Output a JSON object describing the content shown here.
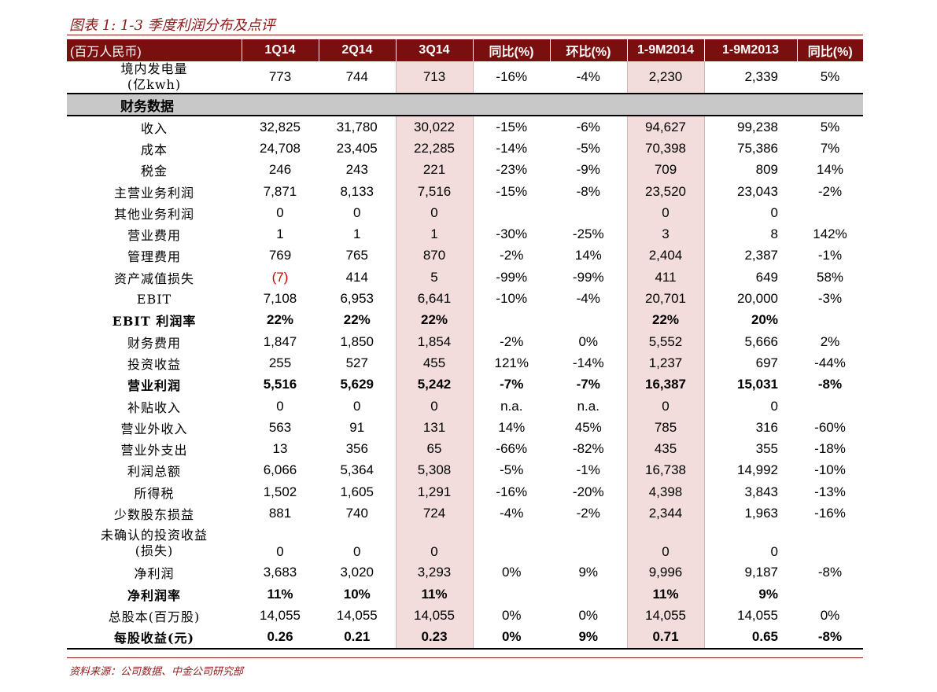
{
  "title": "图表 1: 1-3 季度利润分布及点评",
  "source": "资料来源：公司数据、中金公司研究部",
  "accent_color": "#7a0f0f",
  "highlight_color": "#f2dcdc",
  "headers": [
    "(百万人民币)",
    "1Q14",
    "2Q14",
    "3Q14",
    "同比(%)",
    "环比(%)",
    "1-9M2014",
    "1-9M2013",
    "同比(%)"
  ],
  "electricity": {
    "label_l1": "境内发电量",
    "label_l2": "(亿kwh)",
    "values": [
      "773",
      "744",
      "713",
      "-16%",
      "-4%",
      "2,230",
      "2,339",
      "5%"
    ]
  },
  "section_label": "财务数据",
  "rows": [
    {
      "label": "收入",
      "values": [
        "32,825",
        "31,780",
        "30,022",
        "-15%",
        "-6%",
        "94,627",
        "99,238",
        "5%"
      ]
    },
    {
      "label": "成本",
      "values": [
        "24,708",
        "23,405",
        "22,285",
        "-14%",
        "-5%",
        "70,398",
        "75,386",
        "7%"
      ]
    },
    {
      "label": "税金",
      "values": [
        "246",
        "243",
        "221",
        "-23%",
        "-9%",
        "709",
        "809",
        "14%"
      ]
    },
    {
      "label": "主营业务利润",
      "values": [
        "7,871",
        "8,133",
        "7,516",
        "-15%",
        "-8%",
        "23,520",
        "23,043",
        "-2%"
      ]
    },
    {
      "label": "其他业务利润",
      "values": [
        "0",
        "0",
        "0",
        "",
        "",
        "0",
        "0",
        ""
      ]
    },
    {
      "label": "营业费用",
      "values": [
        "1",
        "1",
        "1",
        "-30%",
        "-25%",
        "3",
        "8",
        "142%"
      ]
    },
    {
      "label": "管理费用",
      "values": [
        "769",
        "765",
        "870",
        "-2%",
        "14%",
        "2,404",
        "2,387",
        "-1%"
      ]
    },
    {
      "label": "资产减值损失",
      "values": [
        "(7)",
        "414",
        "5",
        "-99%",
        "-99%",
        "411",
        "649",
        "58%"
      ]
    },
    {
      "label": "EBIT",
      "values": [
        "7,108",
        "6,953",
        "6,641",
        "-10%",
        "-4%",
        "20,701",
        "20,000",
        "-3%"
      ]
    },
    {
      "label": "EBIT 利润率",
      "values": [
        "22%",
        "22%",
        "22%",
        "",
        "",
        "22%",
        "20%",
        ""
      ]
    },
    {
      "label": "财务费用",
      "values": [
        "1,847",
        "1,850",
        "1,854",
        "-2%",
        "0%",
        "5,552",
        "5,666",
        "2%"
      ]
    },
    {
      "label": "投资收益",
      "values": [
        "255",
        "527",
        "455",
        "121%",
        "-14%",
        "1,237",
        "697",
        "-44%"
      ]
    },
    {
      "label": "营业利润",
      "values": [
        "5,516",
        "5,629",
        "5,242",
        "-7%",
        "-7%",
        "16,387",
        "15,031",
        "-8%"
      ]
    },
    {
      "label": "补贴收入",
      "values": [
        "0",
        "0",
        "0",
        "n.a.",
        "n.a.",
        "0",
        "0",
        ""
      ]
    },
    {
      "label": "营业外收入",
      "values": [
        "563",
        "91",
        "131",
        "14%",
        "45%",
        "785",
        "316",
        "-60%"
      ]
    },
    {
      "label": "营业外支出",
      "values": [
        "13",
        "356",
        "65",
        "-66%",
        "-82%",
        "435",
        "355",
        "-18%"
      ]
    },
    {
      "label": "利润总额",
      "values": [
        "6,066",
        "5,364",
        "5,308",
        "-5%",
        "-1%",
        "16,738",
        "14,992",
        "-10%"
      ]
    },
    {
      "label": "所得税",
      "values": [
        "1,502",
        "1,605",
        "1,291",
        "-16%",
        "-20%",
        "4,398",
        "3,843",
        "-13%"
      ]
    },
    {
      "label": "少数股东损益",
      "values": [
        "881",
        "740",
        "724",
        "-4%",
        "-2%",
        "2,344",
        "1,963",
        "-16%"
      ]
    }
  ],
  "unrecognized": {
    "label_l1": "未确认的投资收益",
    "label_l2": "(损失)",
    "values": [
      "0",
      "0",
      "0",
      "",
      "",
      "0",
      "0",
      ""
    ]
  },
  "rows_tail": [
    {
      "label": "净利润",
      "values": [
        "3,683",
        "3,020",
        "3,293",
        "0%",
        "9%",
        "9,996",
        "9,187",
        "-8%"
      ]
    },
    {
      "label": "净利润率",
      "values": [
        "11%",
        "10%",
        "11%",
        "",
        "",
        "11%",
        "9%",
        ""
      ]
    },
    {
      "label": "总股本(百万股)",
      "values": [
        "14,055",
        "14,055",
        "14,055",
        "0%",
        "0%",
        "14,055",
        "14,055",
        "0%"
      ]
    },
    {
      "label": "每股收益(元)",
      "values": [
        "0.26",
        "0.21",
        "0.23",
        "0%",
        "9%",
        "0.71",
        "0.65",
        "-8%"
      ]
    }
  ]
}
